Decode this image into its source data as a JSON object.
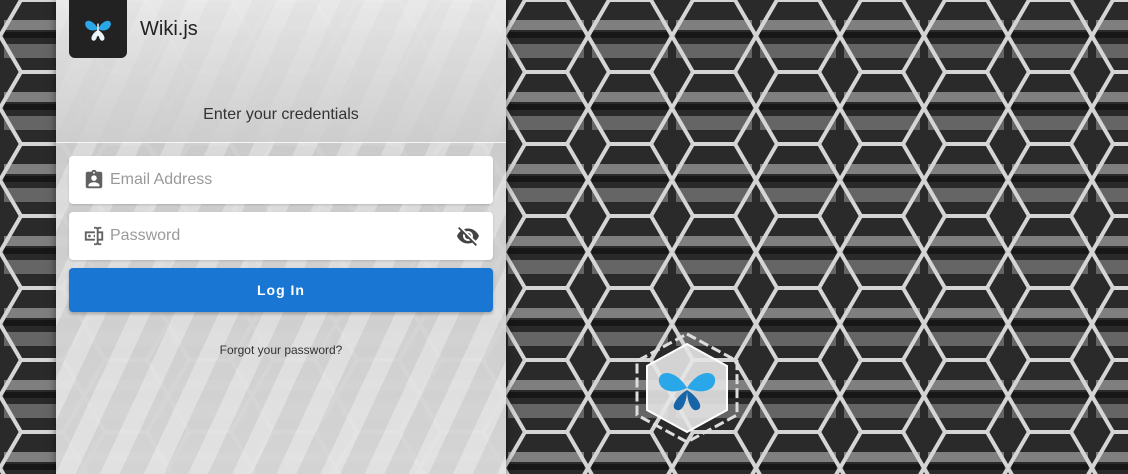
{
  "app": {
    "title": "Wiki.js",
    "logo_icon": "butterfly-logo-icon"
  },
  "login": {
    "subtitle": "Enter your credentials",
    "email": {
      "placeholder": "Email Address",
      "value": "",
      "icon": "account-box-icon"
    },
    "password": {
      "placeholder": "Password",
      "value": "",
      "icon": "password-field-icon",
      "toggle_icon": "eye-off-icon"
    },
    "submit_label": "Log In",
    "forgot_label": "Forgot your password?"
  },
  "colors": {
    "primary": "#1976d2",
    "panel": "#dcdcdc",
    "logo_bg": "#222222",
    "logo_wing": "#2aa7e8"
  }
}
